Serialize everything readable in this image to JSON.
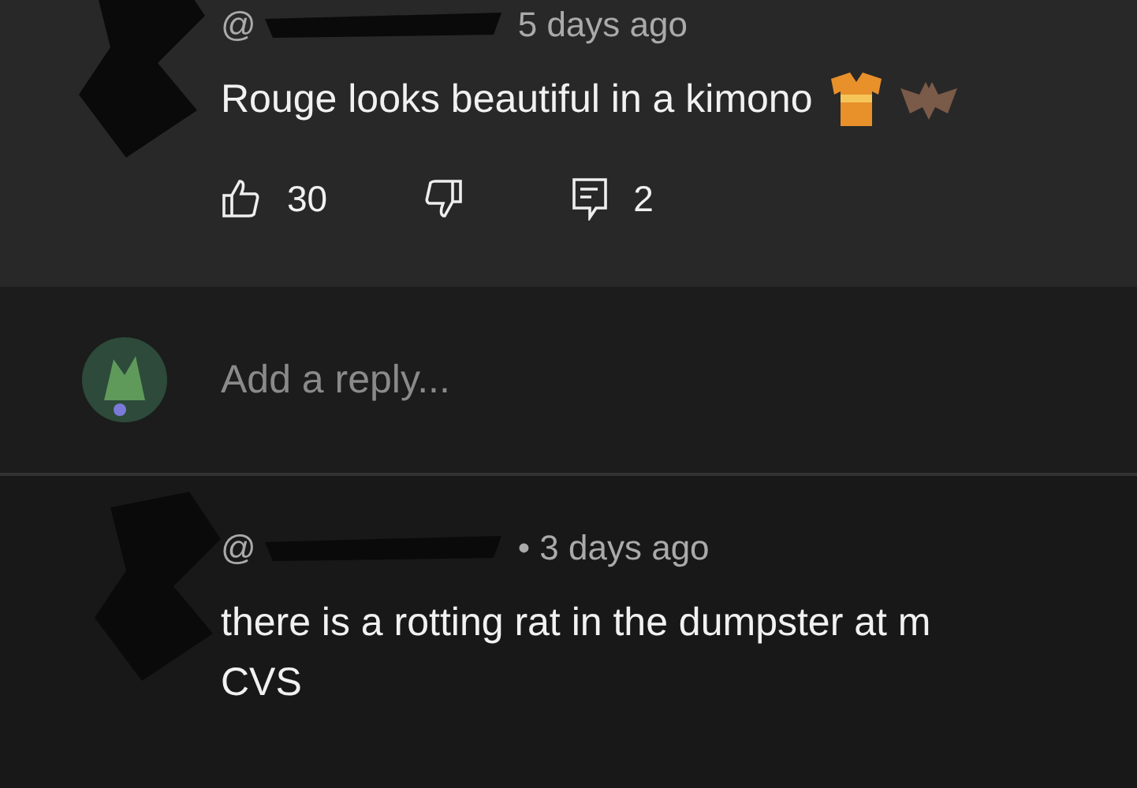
{
  "comments": [
    {
      "handle": "@",
      "time": "5 days ago",
      "lines": [
        "Rouge looks beautiful in a kimono"
      ],
      "emojis": [
        {
          "kind": "kimono"
        },
        {
          "kind": "bat"
        }
      ],
      "likes": "30",
      "replies": "2"
    },
    {
      "handle": "@",
      "time": "• 3 days ago",
      "lines": [
        "there is a rotting rat in the dumpster at m",
        "CVS"
      ]
    }
  ],
  "reply_box": {
    "placeholder": "Add a reply..."
  }
}
